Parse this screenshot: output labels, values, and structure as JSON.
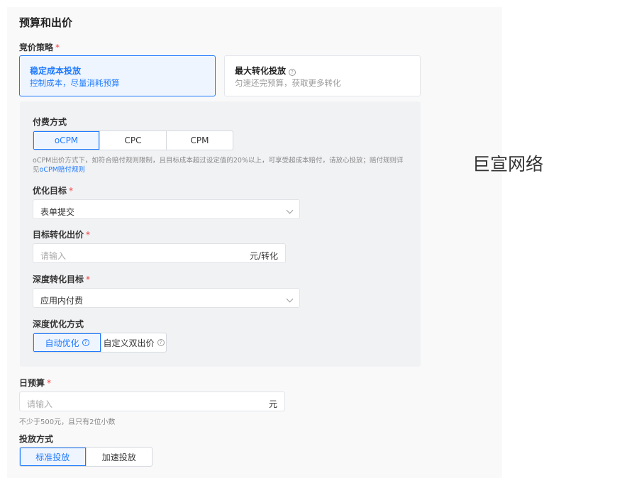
{
  "section_title": "预算和出价",
  "bid_strategy": {
    "label": "竞价策略",
    "required_mark": "*",
    "options": [
      {
        "title": "稳定成本投放",
        "subtitle": "控制成本，尽量消耗预算",
        "selected": true
      },
      {
        "title": "最大转化投放",
        "subtitle": "匀速还完预算，获取更多转化",
        "selected": false,
        "help_icon": "question-circle-icon"
      }
    ]
  },
  "payment": {
    "label": "付费方式",
    "options": [
      "oCPM",
      "CPC",
      "CPM"
    ],
    "selected": "oCPM",
    "hint_line1": "oCPM出价方式下，如符合赔付规则限制，且目标成本超过设定值的20%以上，可享受超成本赔付，请放心投放；赔付规则详",
    "hint_line2_prefix": "见",
    "hint_link": "oCPM赔付规则"
  },
  "optimization_goal": {
    "label": "优化目标",
    "required_mark": "*",
    "value": "表单提交"
  },
  "target_bid": {
    "label": "目标转化出价",
    "required_mark": "*",
    "placeholder": "请输入",
    "suffix": "元/转化"
  },
  "deep_goal": {
    "label": "深度转化目标",
    "required_mark": "*",
    "value": "应用内付费"
  },
  "deep_method": {
    "label": "深度优化方式",
    "options": [
      "自动优化",
      "自定义双出价"
    ],
    "selected": "自动优化"
  },
  "daily_budget": {
    "label": "日预算",
    "required_mark": "*",
    "placeholder": "请输入",
    "suffix": "元",
    "hint": "不少于500元，且只有2位小数"
  },
  "delivery": {
    "label": "投放方式",
    "options": [
      "标准投放",
      "加速投放"
    ],
    "selected": "标准投放"
  },
  "brand": "巨宣网络",
  "colors": {
    "accent": "#1f7aff",
    "required": "#f53f3f"
  }
}
